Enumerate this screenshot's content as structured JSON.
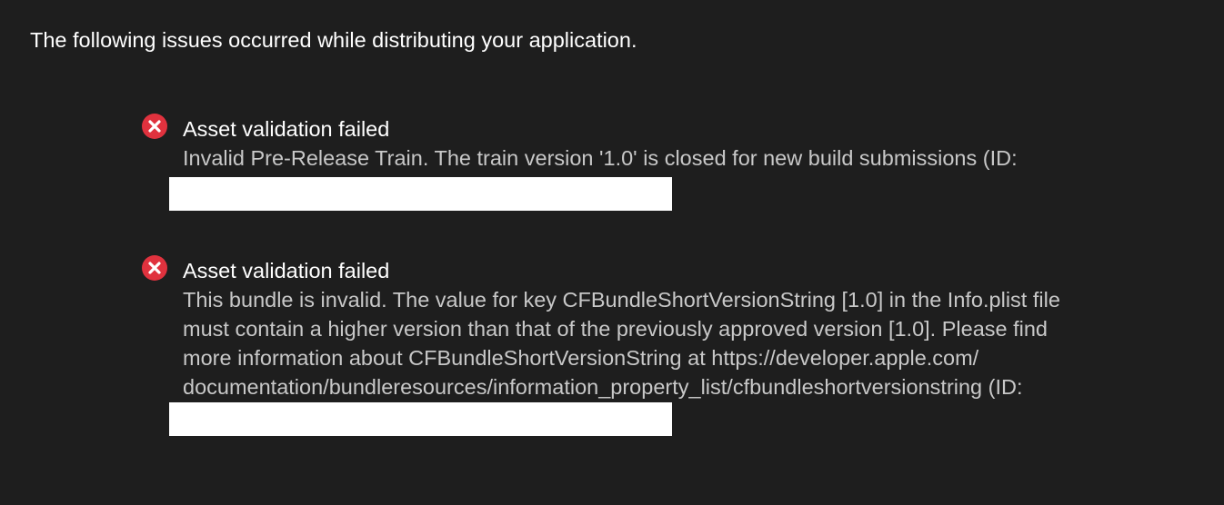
{
  "header": {
    "text": "The following issues occurred while distributing your application."
  },
  "issues": [
    {
      "icon": "error-circle-x-icon",
      "title": "Asset validation failed",
      "message_lines": [
        "Invalid Pre-Release Train. The train version '1.0' is closed for new build submissions (ID:"
      ]
    },
    {
      "icon": "error-circle-x-icon",
      "title": "Asset validation failed",
      "message_lines": [
        "This bundle is invalid. The value for key CFBundleShortVersionString [1.0] in the Info.plist file",
        "must contain a higher version than that of the previously approved version [1.0]. Please find",
        "more information about CFBundleShortVersionString at https://developer.apple.com/",
        "documentation/bundleresources/information_property_list/cfbundleshortversionstring (ID:"
      ]
    }
  ],
  "colors": {
    "background": "#1e1e1e",
    "error_icon": "#e0323e",
    "title_text": "#ffffff",
    "message_text": "#c8c8c8",
    "redaction": "#ffffff"
  }
}
